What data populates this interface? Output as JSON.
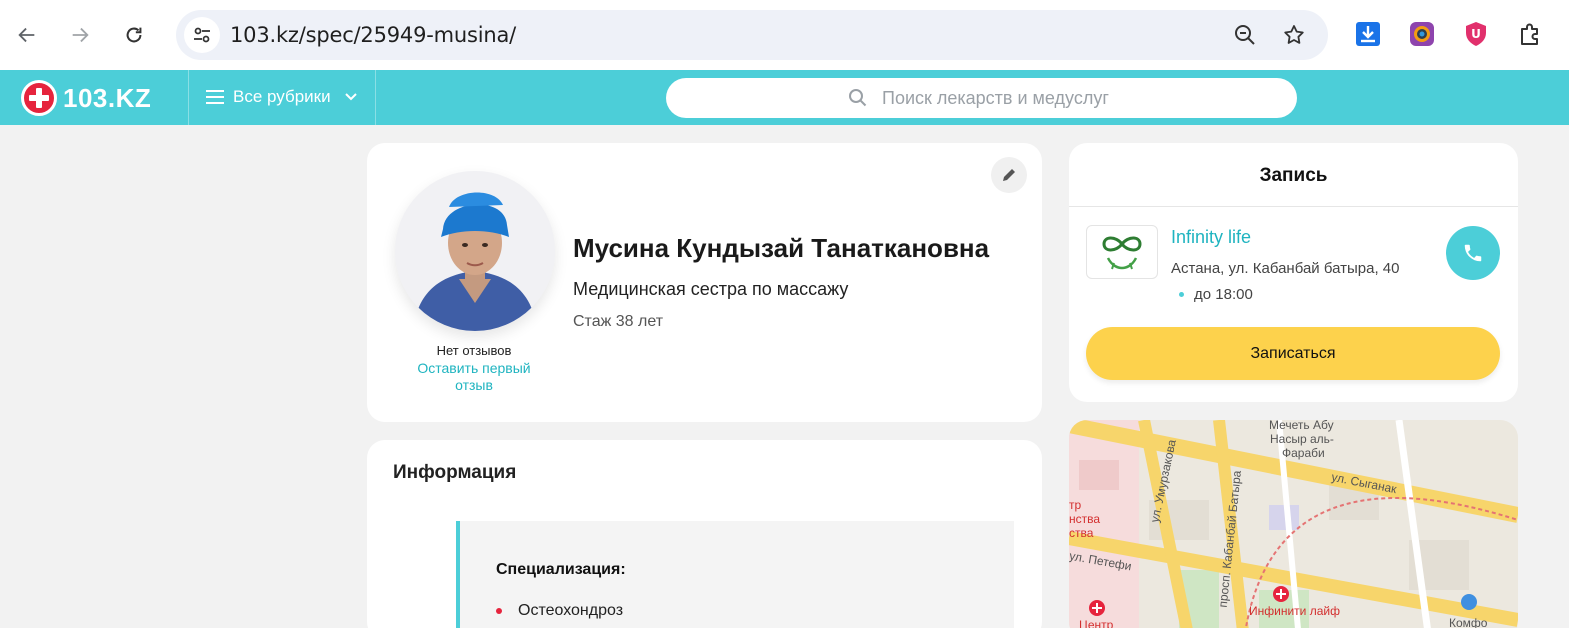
{
  "browser": {
    "url": "103.kz/spec/25949-musina/",
    "icons": [
      "back-icon",
      "forward-icon",
      "reload-icon",
      "site-info-icon",
      "zoom-icon",
      "bookmark-star-icon",
      "download-icon",
      "extension-camera-icon",
      "extension-shield-icon",
      "extensions-puzzle-icon"
    ]
  },
  "header": {
    "logo_text": "103.KZ",
    "rubrics_label": "Все рубрики",
    "search_placeholder": "Поиск лекарств и медуслуг",
    "brand_color": "#4cced8",
    "accent_color": "#e6243d"
  },
  "profile": {
    "name": "Мусина Кундызай Танаткановна",
    "role": "Медицинская сестра по массажу",
    "experience": "Стаж 38 лет",
    "no_reviews": "Нет отзывов",
    "leave_review": "Оставить первый отзыв"
  },
  "info": {
    "title": "Информация",
    "specialization_title": "Специализация:",
    "specializations": [
      "Остеохондроз"
    ]
  },
  "booking": {
    "title": "Запись",
    "clinic_name": "Infinity life",
    "clinic_address": "Астана, ул. Кабанбай батыра, 40",
    "clinic_hours": "до 18:00",
    "book_button": "Записаться",
    "button_color": "#fdd24c"
  },
  "map": {
    "labels": [
      "Мечеть Абу",
      "Насыр аль-",
      "Фараби",
      "ул. Сыганак",
      "ул. Умурзакова",
      "просп. Кабанбай Батыра",
      "ул. Петефи",
      "Инфинити лайф",
      "тр",
      "нства",
      "ства",
      "Центр",
      "Комфо"
    ]
  }
}
